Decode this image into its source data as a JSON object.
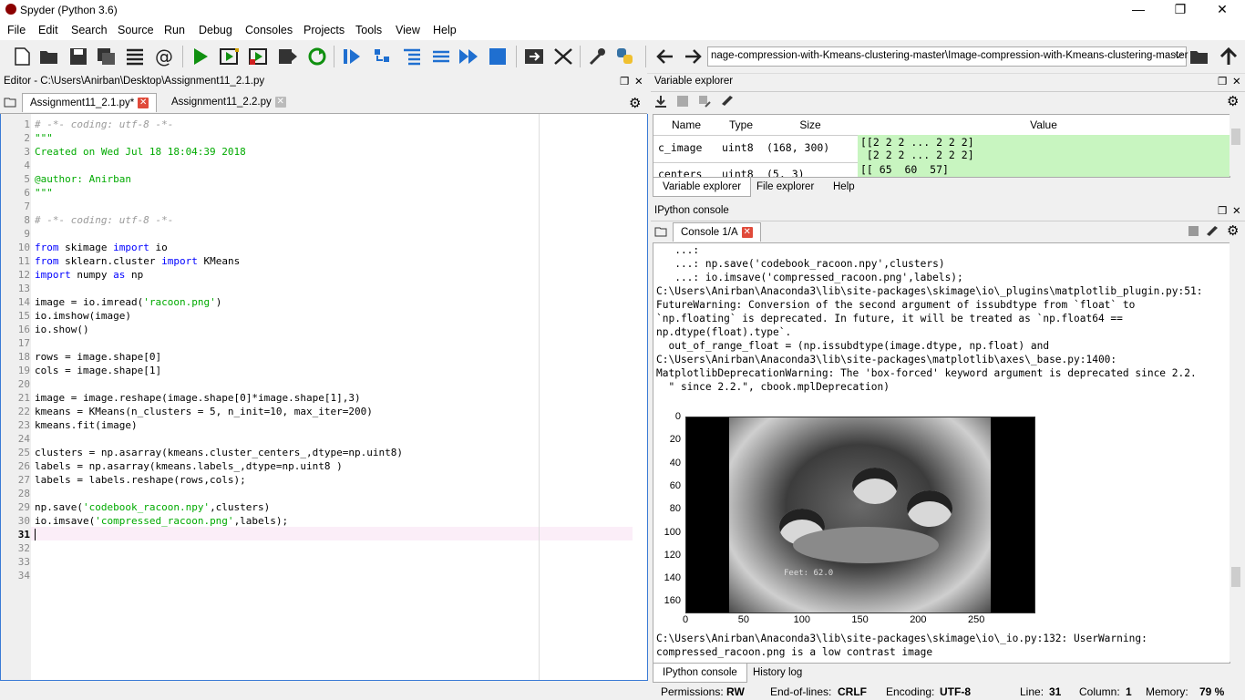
{
  "window": {
    "title": "Spyder (Python 3.6)",
    "minimize": "—",
    "restore": "❐",
    "close": "✕"
  },
  "menu": [
    "File",
    "Edit",
    "Search",
    "Source",
    "Run",
    "Debug",
    "Consoles",
    "Projects",
    "Tools",
    "View",
    "Help"
  ],
  "toolbar": {
    "path": "nage-compression-with-Kmeans-clustering-master\\Image-compression-with-Kmeans-clustering-master"
  },
  "editor": {
    "header": "Editor - C:\\Users\\Anirban\\Desktop\\Assignment11_2.1.py",
    "tabs": [
      "Assignment11_2.1.py*",
      "Assignment11_2.2.py"
    ],
    "line_numbers": [
      "1",
      "2",
      "3",
      "4",
      "5",
      "6",
      "7",
      "8",
      "9",
      "10",
      "11",
      "12",
      "13",
      "14",
      "15",
      "16",
      "17",
      "18",
      "19",
      "20",
      "21",
      "22",
      "23",
      "24",
      "25",
      "26",
      "27",
      "28",
      "29",
      "30",
      "31",
      "32",
      "33",
      "34"
    ],
    "code": {
      "l1": "# -*- coding: utf-8 -*-",
      "l2": "\"\"\"",
      "l3": "Created on Wed Jul 18 18:04:39 2018",
      "l5": "@author: Anirban",
      "l6": "\"\"\"",
      "l8": "# -*- coding: utf-8 -*-",
      "l10a": "from",
      "l10b": " skimage ",
      "l10c": "import",
      "l10d": " io",
      "l11a": "from",
      "l11b": " sklearn.cluster ",
      "l11c": "import",
      "l11d": " KMeans",
      "l12a": "import",
      "l12b": " numpy ",
      "l12c": "as",
      "l12d": " np",
      "l14a": "image = io.imread(",
      "l14b": "'racoon.png'",
      "l14c": ")",
      "l15": "io.imshow(image)",
      "l16": "io.show()",
      "l18": "rows = image.shape[0]",
      "l19": "cols = image.shape[1]",
      "l21": "image = image.reshape(image.shape[0]*image.shape[1],3)",
      "l22": "kmeans = KMeans(n_clusters = 5, n_init=10, max_iter=200)",
      "l23": "kmeans.fit(image)",
      "l25": "clusters = np.asarray(kmeans.cluster_centers_,dtype=np.uint8)",
      "l26": "labels = np.asarray(kmeans.labels_,dtype=np.uint8 )",
      "l27": "labels = labels.reshape(rows,cols);",
      "l29a": "np.save(",
      "l29b": "'codebook_racoon.npy'",
      "l29c": ",clusters)",
      "l30a": "io.imsave(",
      "l30b": "'compressed_racoon.png'",
      "l30c": ",labels);"
    }
  },
  "variable_explorer": {
    "header": "Variable explorer",
    "columns": [
      "Name",
      "Type",
      "Size",
      "Value"
    ],
    "rows": [
      {
        "name": "c_image",
        "type": "uint8",
        "size": "(168, 300)",
        "value1": "[[2 2 2 ... 2 2 2]",
        "value2": " [2 2 2 ... 2 2 2]"
      },
      {
        "name": "centers",
        "type": "uint8",
        "size": "(5, 3)",
        "value1": "[[ 65  60  57]"
      }
    ],
    "tabs": [
      "Variable explorer",
      "File explorer",
      "Help"
    ]
  },
  "ipython": {
    "header": "IPython console",
    "tab": "Console 1/A",
    "lines": [
      "   ...: ",
      "   ...: np.save('codebook_racoon.npy',clusters)",
      "   ...: io.imsave('compressed_racoon.png',labels);",
      "C:\\Users\\Anirban\\Anaconda3\\lib\\site-packages\\skimage\\io\\_plugins\\matplotlib_plugin.py:51:",
      "FutureWarning: Conversion of the second argument of issubdtype from `float` to",
      "`np.floating` is deprecated. In future, it will be treated as `np.float64 ==",
      "np.dtype(float).type`.",
      "  out_of_range_float = (np.issubdtype(image.dtype, np.float) and",
      "C:\\Users\\Anirban\\Anaconda3\\lib\\site-packages\\matplotlib\\axes\\_base.py:1400:",
      "MatplotlibDeprecationWarning: The 'box-forced' keyword argument is deprecated since 2.2.",
      "  \" since 2.2.\", cbook.mplDeprecation)"
    ],
    "after_lines": [
      "C:\\Users\\Anirban\\Anaconda3\\lib\\site-packages\\skimage\\io\\_io.py:132: UserWarning:",
      "compressed_racoon.png is a low contrast image"
    ],
    "plot": {
      "y_ticks": [
        "0",
        "20",
        "40",
        "60",
        "80",
        "100",
        "120",
        "140",
        "160"
      ],
      "x_ticks": [
        "0",
        "50",
        "100",
        "150",
        "200",
        "250"
      ],
      "overlay_text": "Feet:   62.0"
    },
    "tabs": [
      "IPython console",
      "History log"
    ]
  },
  "status": {
    "permissions_label": "Permissions:",
    "permissions": "RW",
    "eol_label": "End-of-lines:",
    "eol": "CRLF",
    "encoding_label": "Encoding:",
    "encoding": "UTF-8",
    "line_label": "Line:",
    "line": "31",
    "column_label": "Column:",
    "column": "1",
    "memory_label": "Memory:",
    "memory": "79 %"
  }
}
